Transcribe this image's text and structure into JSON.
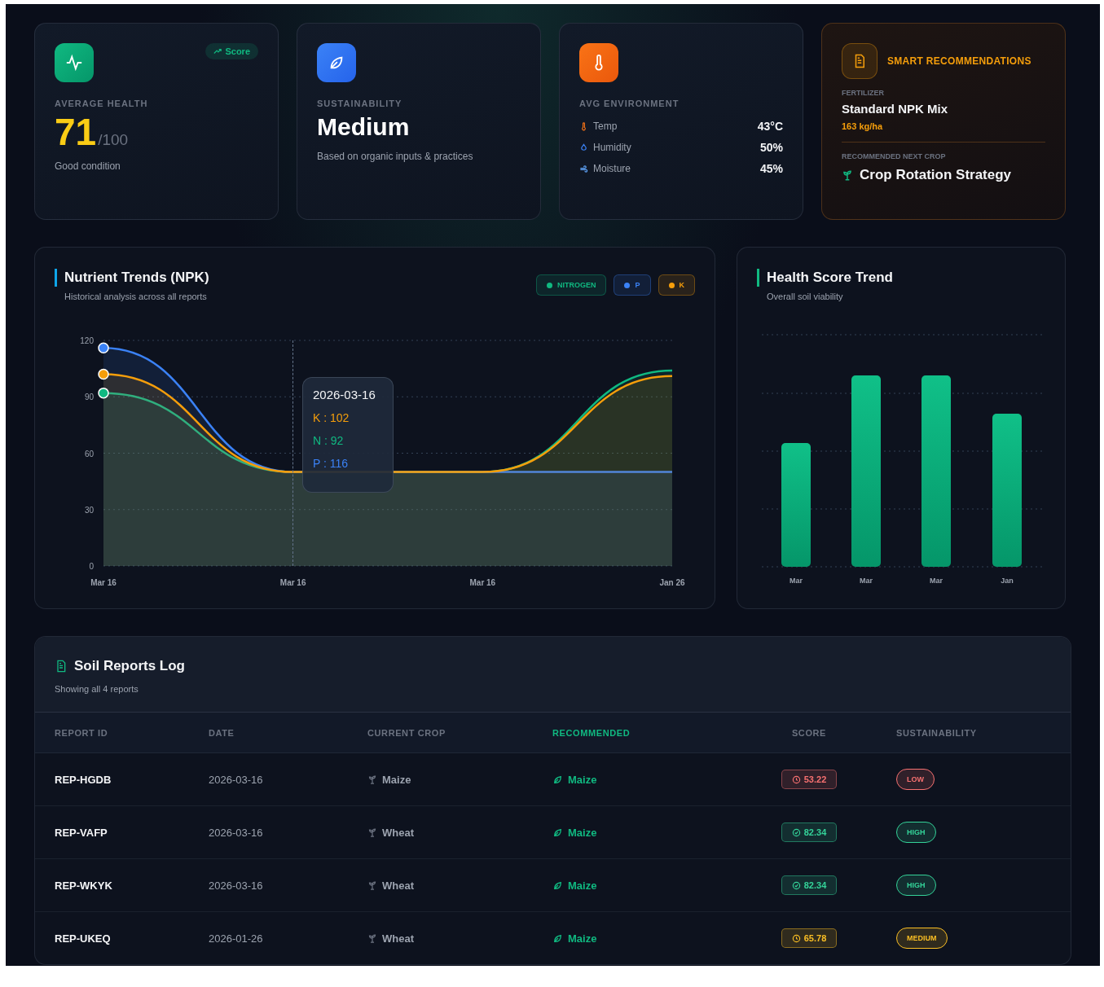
{
  "stats": [
    {
      "kind": "health",
      "label": "AVERAGE HEALTH",
      "badge": "Score",
      "value": "71",
      "suffix": "/100",
      "note": "Good condition"
    },
    {
      "kind": "sustainability",
      "label": "SUSTAINABILITY",
      "value": "Medium",
      "note": "Based on organic inputs & practices"
    },
    {
      "kind": "environment",
      "label": "AVG ENVIRONMENT",
      "metrics": [
        {
          "kind": "temp",
          "label": "Temp",
          "value": "43°C"
        },
        {
          "kind": "humidity",
          "label": "Humidity",
          "value": "50%"
        },
        {
          "kind": "moisture",
          "label": "Moisture",
          "value": "45%"
        }
      ]
    },
    {
      "kind": "recommendation",
      "title": "SMART RECOMMENDATIONS",
      "fertilizer_label": "FERTILIZER",
      "fertilizer": "Standard NPK Mix",
      "rate": "163 kg/ha",
      "crop_label": "RECOMMENDED NEXT CROP",
      "crop": "Crop Rotation Strategy"
    }
  ],
  "nutrient_trends": {
    "title": "Nutrient Trends (NPK)",
    "subtitle": "Historical analysis across all reports",
    "tooltip": {
      "date": "2026-03-16",
      "lines": [
        {
          "text": "K : 102",
          "color": "#f59e0b"
        },
        {
          "text": "N : 92",
          "color": "#10b981"
        },
        {
          "text": "P : 116",
          "color": "#3b82f6"
        }
      ]
    },
    "chart_data": {
      "type": "area",
      "grid": true,
      "categories": [
        "Mar 16",
        "Mar 16",
        "Mar 16",
        "Jan 26"
      ],
      "ylim": [
        0,
        120
      ],
      "yticks": [
        0,
        30,
        60,
        90,
        120
      ],
      "series": [
        {
          "name": "NITROGEN",
          "color": "#10b981",
          "values": [
            92,
            50,
            50,
            104
          ]
        },
        {
          "name": "P",
          "color": "#3b82f6",
          "values": [
            116,
            50,
            50,
            50
          ]
        },
        {
          "name": "K",
          "color": "#f59e0b",
          "values": [
            102,
            50,
            50,
            101
          ]
        }
      ]
    }
  },
  "health_trend": {
    "title": "Health Score Trend",
    "subtitle": "Overall soil viability",
    "x_labels": [
      "Mar",
      "Mar",
      "Mar",
      "Jan"
    ]
  },
  "reports": {
    "title": "Soil Reports Log",
    "subtitle": "Showing all 4 reports",
    "columns": [
      "REPORT ID",
      "DATE",
      "CURRENT CROP",
      "RECOMMENDED",
      "SCORE",
      "SUSTAINABILITY"
    ],
    "rows": [
      {
        "id": "REP-HGDB",
        "date": "2026-03-16",
        "crop": "Maize",
        "recommended": "Maize",
        "score": {
          "text": "53.22",
          "kind": "alert",
          "color": "#f87171"
        },
        "sustainability": {
          "text": "LOW",
          "color": "#f87171"
        }
      },
      {
        "id": "REP-VAFP",
        "date": "2026-03-16",
        "crop": "Wheat",
        "recommended": "Maize",
        "score": {
          "text": "82.34",
          "kind": "check",
          "color": "#34d399"
        },
        "sustainability": {
          "text": "HIGH",
          "color": "#34d399"
        }
      },
      {
        "id": "REP-WKYK",
        "date": "2026-03-16",
        "crop": "Wheat",
        "recommended": "Maize",
        "score": {
          "text": "82.34",
          "kind": "check",
          "color": "#34d399"
        },
        "sustainability": {
          "text": "HIGH",
          "color": "#34d399"
        }
      },
      {
        "id": "REP-UKEQ",
        "date": "2026-01-26",
        "crop": "Wheat",
        "recommended": "Maize",
        "score": {
          "text": "65.78",
          "kind": "alert",
          "color": "#fbbf24"
        },
        "sustainability": {
          "text": "MEDIUM",
          "color": "#fbbf24"
        }
      }
    ]
  }
}
